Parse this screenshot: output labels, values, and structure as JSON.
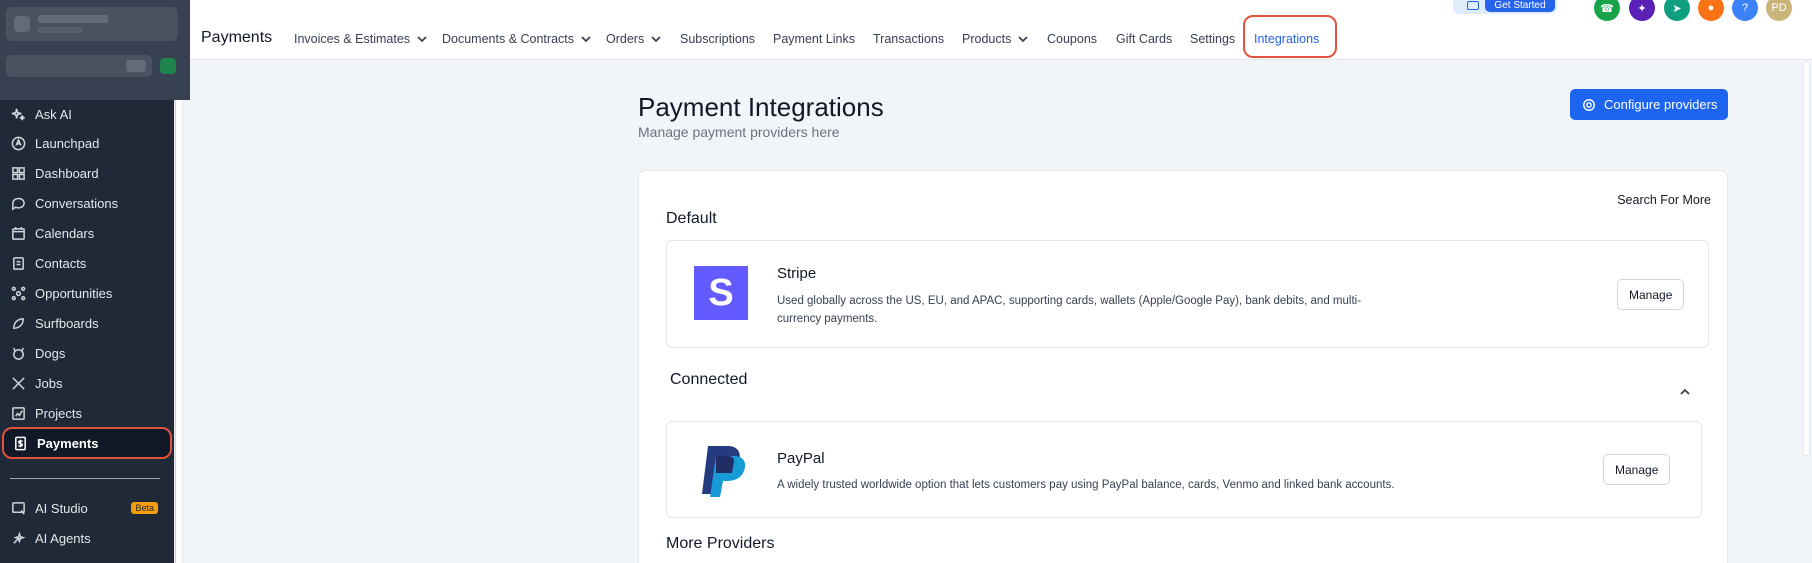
{
  "sidebar": {
    "items": [
      {
        "label": "Ask AI",
        "icon": "sparkle-icon"
      },
      {
        "label": "Launchpad",
        "icon": "rocket-icon"
      },
      {
        "label": "Dashboard",
        "icon": "grid-icon"
      },
      {
        "label": "Conversations",
        "icon": "chat-icon"
      },
      {
        "label": "Calendars",
        "icon": "calendar-icon"
      },
      {
        "label": "Contacts",
        "icon": "contacts-icon"
      },
      {
        "label": "Opportunities",
        "icon": "network-icon"
      },
      {
        "label": "Surfboards",
        "icon": "surfboard-icon"
      },
      {
        "label": "Dogs",
        "icon": "dog-icon"
      },
      {
        "label": "Jobs",
        "icon": "tools-icon"
      },
      {
        "label": "Projects",
        "icon": "chart-icon"
      },
      {
        "label": "Payments",
        "icon": "payments-icon"
      },
      {
        "label": "AI Studio",
        "icon": "ai-studio-icon",
        "badge": "Beta"
      },
      {
        "label": "AI Agents",
        "icon": "ai-agents-icon"
      }
    ]
  },
  "header": {
    "title": "Payments",
    "tabs": [
      {
        "label": "Invoices & Estimates",
        "dropdown": true
      },
      {
        "label": "Documents & Contracts",
        "dropdown": true
      },
      {
        "label": "Orders",
        "dropdown": true
      },
      {
        "label": "Subscriptions"
      },
      {
        "label": "Payment Links"
      },
      {
        "label": "Transactions"
      },
      {
        "label": "Products",
        "dropdown": true
      },
      {
        "label": "Coupons"
      },
      {
        "label": "Gift Cards"
      },
      {
        "label": "Settings"
      },
      {
        "label": "Integrations",
        "active": true
      }
    ],
    "get_started": "Get Started",
    "avatar_initials": "PD",
    "help": "?"
  },
  "main": {
    "title": "Payment Integrations",
    "subtitle": "Manage payment providers here",
    "configure_button": "Configure providers",
    "search_more": "Search For More",
    "default_section": "Default",
    "connected_section": "Connected",
    "more_section": "More Providers",
    "providers": {
      "stripe": {
        "name": "Stripe",
        "logo": "S",
        "description_line1": "Used globally across the US, EU, and APAC, supporting cards, wallets (Apple/Google Pay), bank debits, and multi-",
        "description_line2": "currency payments.",
        "action": "Manage"
      },
      "paypal": {
        "name": "PayPal",
        "description": "A widely trusted worldwide option that lets customers pay using PayPal balance, cards, Venmo and linked bank accounts.",
        "action": "Manage"
      }
    }
  },
  "colors": {
    "accent": "#1d64f0",
    "highlight": "#e0533f",
    "sidebar_bg": "#1f2937",
    "stripe": "#635bff"
  }
}
